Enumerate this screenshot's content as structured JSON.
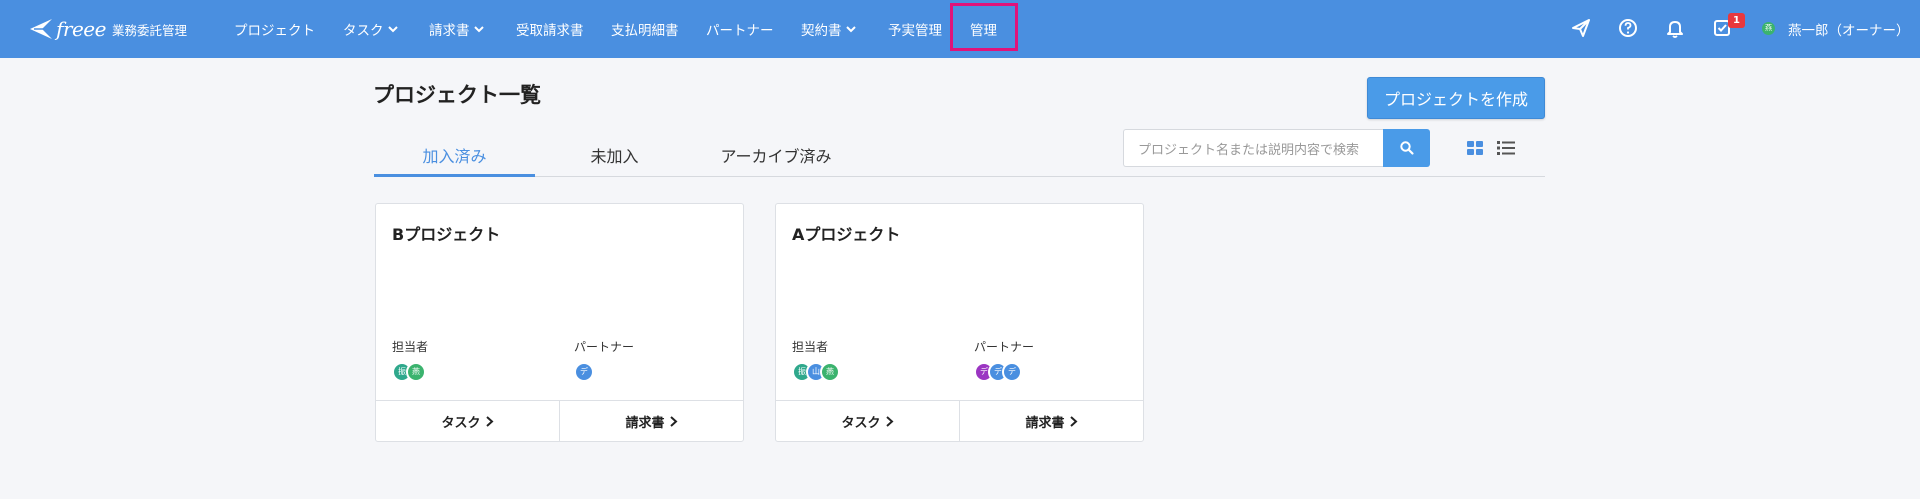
{
  "nav": {
    "logo_text": "freee",
    "logo_sub": "業務委託管理",
    "items": [
      {
        "label": "プロジェクト"
      },
      {
        "label": "タスク"
      },
      {
        "label": "請求書"
      },
      {
        "label": "受取請求書"
      },
      {
        "label": "支払明細書"
      },
      {
        "label": "パートナー"
      },
      {
        "label": "契約書"
      },
      {
        "label": "予実管理"
      },
      {
        "label": "管理"
      }
    ],
    "notification_count": "1",
    "user_avatar_text": "燕",
    "user_name": "燕一郎（オーナー）"
  },
  "page": {
    "title": "プロジェクト一覧",
    "create_button": "プロジェクトを作成"
  },
  "tabs": [
    {
      "label": "加入済み"
    },
    {
      "label": "未加入"
    },
    {
      "label": "アーカイブ済み"
    }
  ],
  "search": {
    "placeholder": "プロジェクト名または説明内容で検索"
  },
  "cards": [
    {
      "title": "Bプロジェクト",
      "members_label": "担当者",
      "partners_label": "パートナー",
      "members": [
        {
          "text": "振",
          "color": "#2fa88c"
        },
        {
          "text": "燕",
          "color": "#3bb36e"
        }
      ],
      "partners": [
        {
          "text": "デ",
          "color": "#4a8fe0"
        }
      ],
      "task_button": "タスク",
      "invoice_button": "請求書"
    },
    {
      "title": "Aプロジェクト",
      "members_label": "担当者",
      "partners_label": "パートナー",
      "members": [
        {
          "text": "振",
          "color": "#2fa88c"
        },
        {
          "text": "山",
          "color": "#4a8fe0"
        },
        {
          "text": "燕",
          "color": "#3bb36e"
        }
      ],
      "partners": [
        {
          "text": "デ",
          "color": "#9b35c2"
        },
        {
          "text": "デ",
          "color": "#4a8fe0"
        },
        {
          "text": "デ",
          "color": "#4a8fe0"
        }
      ],
      "task_button": "タスク",
      "invoice_button": "請求書"
    }
  ],
  "colors": {
    "header": "#4a8fe0",
    "accent": "#4a8fe0",
    "highlight": "#e0137a"
  }
}
